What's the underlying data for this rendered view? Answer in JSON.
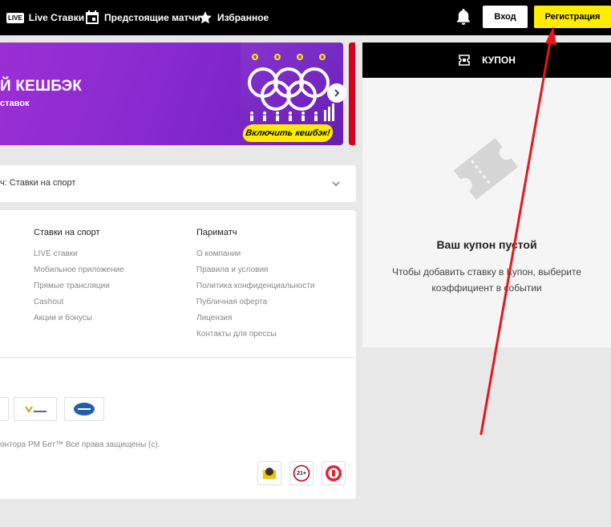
{
  "header": {
    "live_badge": "LIVE",
    "live_label": "Live Ставки",
    "upcoming_label": "Предстоящие матчи",
    "favorites_label": "Избранное",
    "login_label": "Вход",
    "register_label": "Регистрация",
    "accent_color": "#ffed00"
  },
  "banner": {
    "title": "Й КЕШБЭК",
    "subtitle": "ставок",
    "cta_label": "Включить кешбэк!",
    "background": "#8a2bd0"
  },
  "dropdown": {
    "text": "ч: Ставки на спорт"
  },
  "footer": {
    "columns": [
      {
        "title": "Ставки на спорт",
        "links": [
          "LIVE ставки",
          "Мобильное приложение",
          "Прямые трансляции",
          "Cashout",
          "Акции и бонусы"
        ]
      },
      {
        "title": "Париматч",
        "links": [
          "О компании",
          "Правила и условия",
          "Политика конфиденциальности",
          "Публичная оферта",
          "Лицензия",
          "Контакты для прессы"
        ]
      }
    ],
    "copyright": "онтора РМ Бет™ Все права защищены (с).",
    "age_badge": "21+"
  },
  "coupon": {
    "title": "КУПОН",
    "empty_title": "Ваш купон пустой",
    "empty_hint": "Чтобы добавить ставку в Купон, выберите коэффициент в событии"
  },
  "annotation": {
    "arrow_color": "#e8151b"
  }
}
